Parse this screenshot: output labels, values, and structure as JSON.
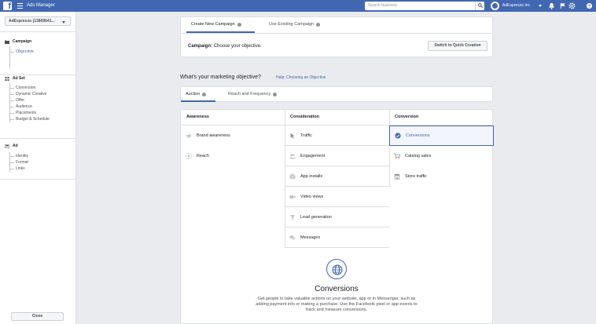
{
  "topbar": {
    "app_title": "Ads Manager",
    "search_placeholder": "Search business",
    "account_name": "AdEspresso Inc"
  },
  "sidebar": {
    "account_select": "AdEspresso (13869641...",
    "campaign": {
      "label": "Campaign",
      "items": [
        "Objective"
      ]
    },
    "adset": {
      "label": "Ad Set",
      "items": [
        "Conversion",
        "Dynamic Creative",
        "Offer",
        "Audience",
        "Placements",
        "Budget & Schedule"
      ]
    },
    "ad": {
      "label": "Ad",
      "items": [
        "Identity",
        "Format",
        "Links"
      ]
    },
    "close_label": "Close"
  },
  "campaign_card": {
    "tabs": [
      "Create New Campaign",
      "Use Existing Campaign"
    ],
    "campaign_label": "Campaign:",
    "campaign_prompt": "Choose your objective.",
    "quick_button": "Switch to Quick Creation"
  },
  "objective": {
    "question": "What's your marketing objective?",
    "help_link": "Help: Choosing an Objective",
    "buying_tabs": [
      "Auction",
      "Reach and Frequency"
    ],
    "columns": [
      {
        "title": "Awareness",
        "options": [
          {
            "label": "Brand awareness",
            "icon": "megaphone-icon"
          },
          {
            "label": "Reach",
            "icon": "reach-icon"
          }
        ]
      },
      {
        "title": "Consideration",
        "options": [
          {
            "label": "Traffic",
            "icon": "cursor-icon"
          },
          {
            "label": "Engagement",
            "icon": "people-icon"
          },
          {
            "label": "App installs",
            "icon": "box-icon"
          },
          {
            "label": "Video views",
            "icon": "video-icon"
          },
          {
            "label": "Lead generation",
            "icon": "funnel-icon"
          },
          {
            "label": "Messages",
            "icon": "chat-icon"
          }
        ]
      },
      {
        "title": "Conversion",
        "options": [
          {
            "label": "Conversions",
            "icon": "check-circle-icon",
            "selected": true
          },
          {
            "label": "Catalog sales",
            "icon": "cart-icon"
          },
          {
            "label": "Store traffic",
            "icon": "store-icon"
          }
        ]
      }
    ],
    "selected_title": "Conversions",
    "selected_description": "Get people to take valuable actions on your website, app or in Messenger, such as adding payment info or making a purchase. Use the Facebook pixel or app events to track and measure conversions."
  },
  "colors": {
    "brand_blue": "#4267b2",
    "page_bg": "#e9ebee",
    "border": "#dddfe2"
  }
}
